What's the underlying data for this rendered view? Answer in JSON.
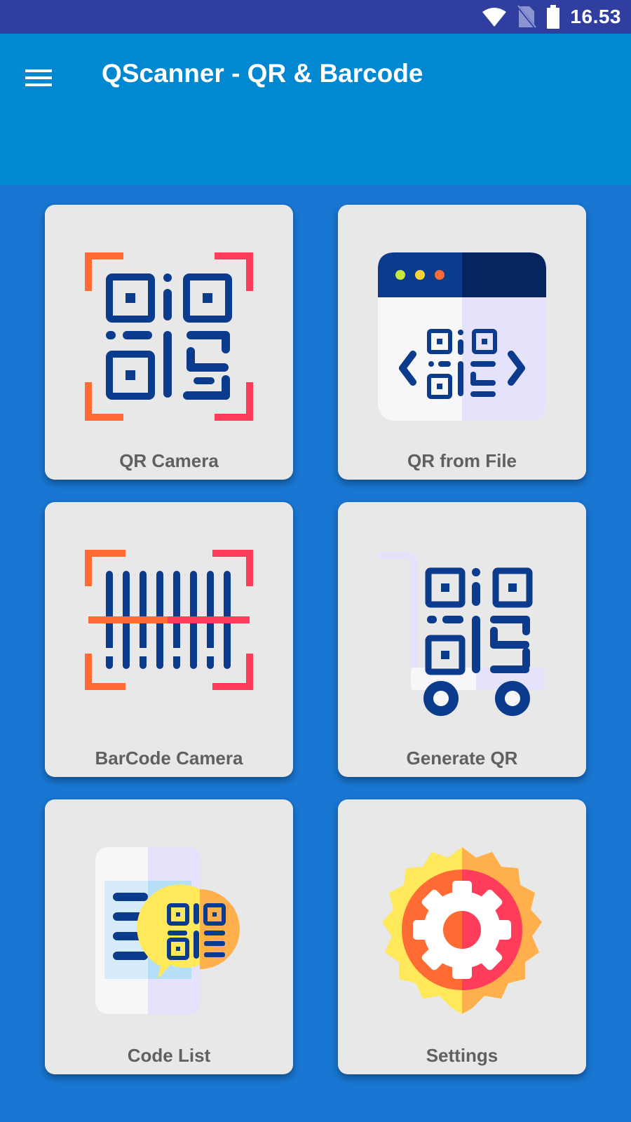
{
  "status_bar": {
    "time": "16.53"
  },
  "app_bar": {
    "title": "QScanner - QR & Barcode"
  },
  "menu": [
    {
      "label": "QR Camera",
      "icon": "qr-scan-icon"
    },
    {
      "label": "QR from File",
      "icon": "qr-file-browser-icon"
    },
    {
      "label": "BarCode Camera",
      "icon": "barcode-scan-icon"
    },
    {
      "label": "Generate QR",
      "icon": "qr-cart-icon"
    },
    {
      "label": "Code List",
      "icon": "code-list-icon"
    },
    {
      "label": "Settings",
      "icon": "gear-icon"
    }
  ],
  "colors": {
    "status_bar": "#303f9f",
    "app_bar": "#0288d1",
    "background": "#1976d2",
    "card": "#e8e8e8",
    "label": "#5f6060",
    "icon_navy": "#0b3b8c",
    "icon_orange": "#ff6b35",
    "icon_red": "#ff3d5a"
  }
}
